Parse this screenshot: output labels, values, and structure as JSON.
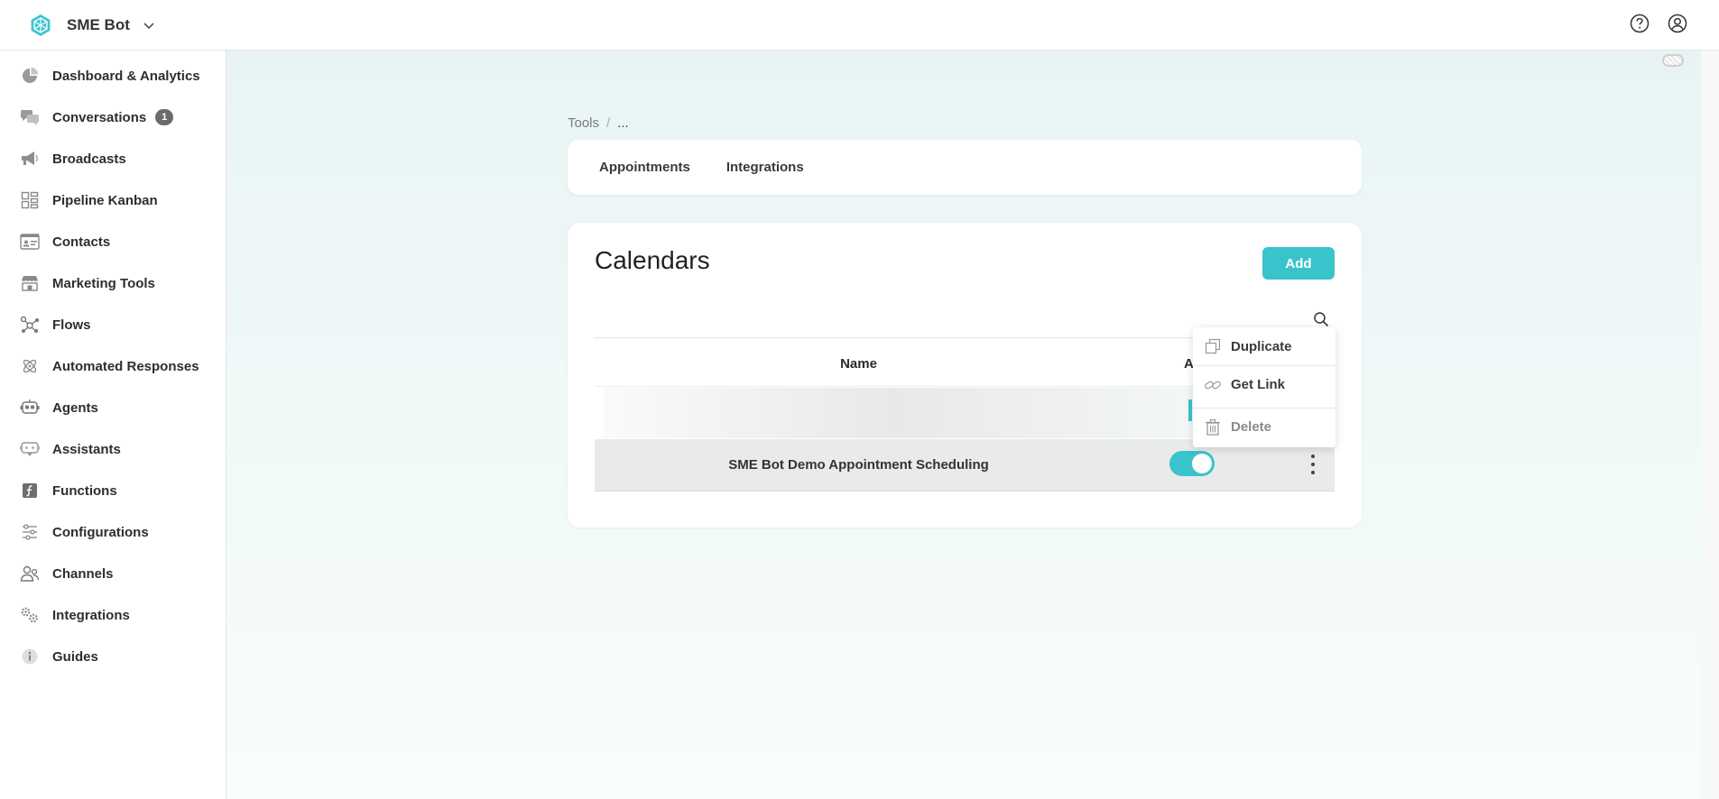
{
  "header": {
    "brand_name": "SME Bot",
    "icons": [
      "brand-logo-icon",
      "chevron-down-icon",
      "help-icon",
      "user-account-icon"
    ]
  },
  "sidebar": {
    "items": [
      {
        "label": "Dashboard & Analytics",
        "icon": "pie-chart-icon"
      },
      {
        "label": "Conversations",
        "icon": "chat-bubbles-icon",
        "badge": "1"
      },
      {
        "label": "Broadcasts",
        "icon": "megaphone-icon"
      },
      {
        "label": "Pipeline Kanban",
        "icon": "kanban-icon"
      },
      {
        "label": "Contacts",
        "icon": "contact-card-icon"
      },
      {
        "label": "Marketing Tools",
        "icon": "storefront-icon"
      },
      {
        "label": "Flows",
        "icon": "flow-nodes-icon"
      },
      {
        "label": "Automated Responses",
        "icon": "atom-icon"
      },
      {
        "label": "Agents",
        "icon": "robot-icon"
      },
      {
        "label": "Assistants",
        "icon": "assistant-bubble-icon"
      },
      {
        "label": "Functions",
        "icon": "function-box-icon"
      },
      {
        "label": "Configurations",
        "icon": "sliders-icon"
      },
      {
        "label": "Channels",
        "icon": "channels-users-icon"
      },
      {
        "label": "Integrations",
        "icon": "gears-icon"
      },
      {
        "label": "Guides",
        "icon": "info-icon"
      }
    ]
  },
  "breadcrumb": {
    "root": "Tools",
    "separator": "/",
    "current": "..."
  },
  "tabs": [
    {
      "label": "Appointments"
    },
    {
      "label": "Integrations"
    }
  ],
  "calendars": {
    "title": "Calendars",
    "add_label": "Add",
    "columns": {
      "name": "Name",
      "active": "A"
    },
    "rows": [
      {
        "name": "SME Bot Demo Appointment Scheduling",
        "active": true
      }
    ]
  },
  "row_menu": {
    "items": [
      {
        "label": "Duplicate",
        "icon": "duplicate-icon"
      },
      {
        "label": "Get Link",
        "icon": "link-icon"
      },
      {
        "label": "Delete",
        "icon": "trash-icon"
      }
    ]
  },
  "colors": {
    "accent": "#39c4cc",
    "badge": "#6b6b6b",
    "row_highlight": "#e9eaea"
  }
}
